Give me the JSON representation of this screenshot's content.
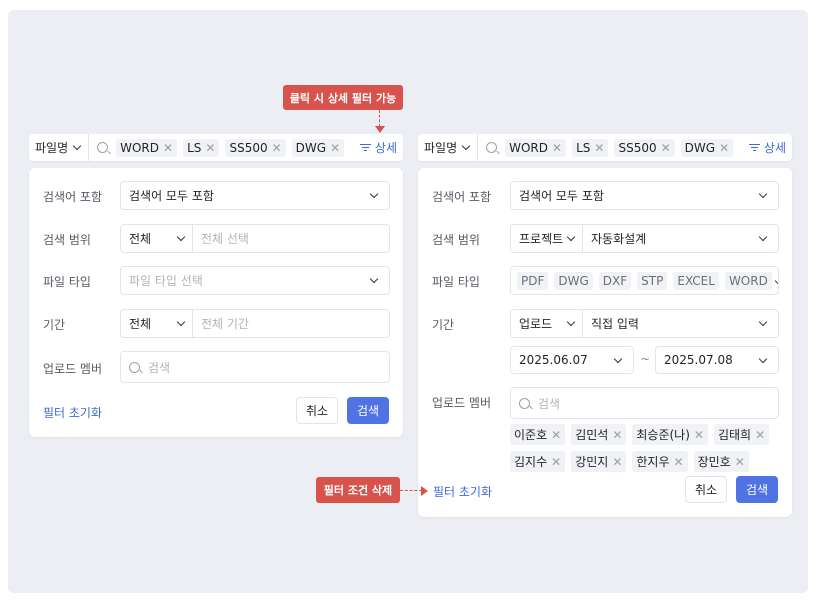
{
  "callouts": {
    "top": "클릭 시 상세 필터 가능",
    "bottom": "필터 조건 삭제"
  },
  "search_bar": {
    "field_select": "파일명",
    "chips": [
      "WORD",
      "LS",
      "SS500",
      "DWG"
    ],
    "detail_label": "상세"
  },
  "labels": {
    "keyword_include": "검색어 포함",
    "scope": "검색 범위",
    "file_type": "파일 타입",
    "period": "기간",
    "upload_member": "업로드 멤버"
  },
  "left": {
    "keyword_include": "검색어 모두 포함",
    "scope_select": "전체",
    "scope_placeholder": "전체 선택",
    "file_type_placeholder": "파일 타입 선택",
    "period_select": "전체",
    "period_placeholder": "전체 기간",
    "member_placeholder": "검색"
  },
  "right": {
    "keyword_include": "검색어 모두 포함",
    "scope_select": "프로젝트",
    "scope_value": "자동화설계",
    "file_types": [
      "PDF",
      "DWG",
      "DXF",
      "STP",
      "EXCEL",
      "WORD"
    ],
    "period_select": "업로드",
    "period_value": "직접 입력",
    "date_from": "2025.06.07",
    "date_sep": "~",
    "date_to": "2025.07.08",
    "member_placeholder": "검색",
    "members": [
      "이준호",
      "김민석",
      "최승준(나)",
      "김태희",
      "김지수",
      "강민지",
      "한지우",
      "장민호"
    ]
  },
  "footer": {
    "reset": "필터 초기화",
    "cancel": "취소",
    "search": "검색"
  },
  "colors": {
    "accent": "#4f73e3",
    "callout": "#d8534c"
  }
}
